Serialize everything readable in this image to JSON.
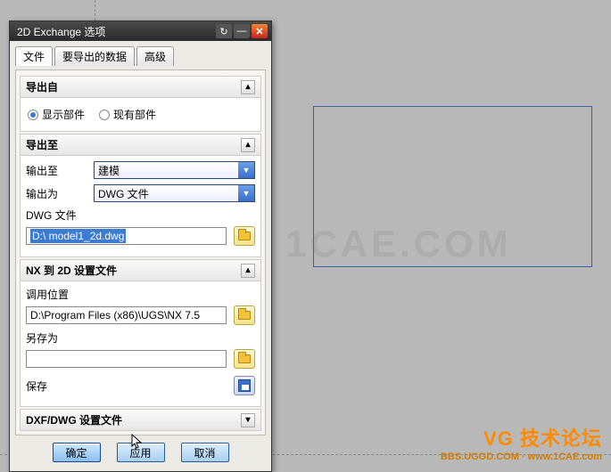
{
  "window": {
    "title": "2D Exchange 选项",
    "reset_tooltip": "重置",
    "minimize_tooltip": "最小化",
    "close_tooltip": "关闭"
  },
  "tabs": {
    "file": "文件",
    "export_data": "要导出的数据",
    "advanced": "高级"
  },
  "sections": {
    "export_from": {
      "title": "导出自",
      "show_part": "显示部件",
      "current_part": "现有部件"
    },
    "export_to": {
      "title": "导出至",
      "output_to_label": "输出至",
      "output_to_value": "建模",
      "output_as_label": "输出为",
      "output_as_value": "DWG 文件",
      "dwg_file_label": "DWG 文件",
      "dwg_file_value": "D:\\ model1_2d.dwg"
    },
    "nx2d": {
      "title": "NX 到 2D 设置文件",
      "load_label": "调用位置",
      "load_value": "D:\\Program Files (x86)\\UGS\\NX 7.5",
      "saveas_label": "另存为",
      "saveas_value": "",
      "save_label": "保存"
    },
    "dxfdwg": {
      "title": "DXF/DWG 设置文件"
    }
  },
  "buttons": {
    "ok": "确定",
    "apply": "应用",
    "cancel": "取消"
  },
  "watermark": {
    "bg": "1CAE.COM",
    "logo": "VG 技术论坛",
    "url": "BBS.UGGD.COM · www.1CAE.com"
  }
}
